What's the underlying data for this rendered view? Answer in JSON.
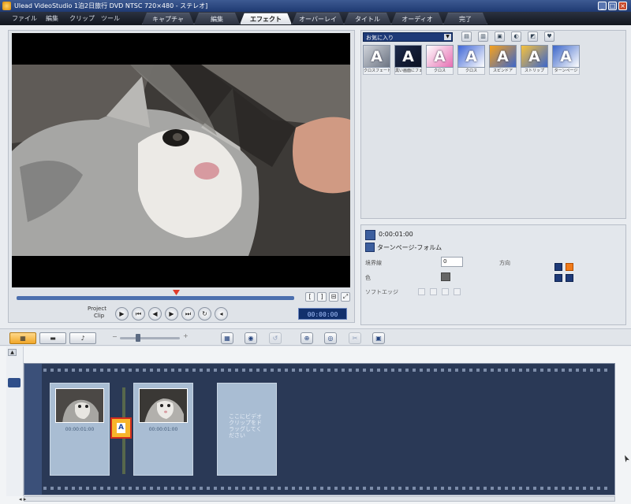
{
  "window": {
    "title": "Ulead VideoStudio 1泊2日旅行 DVD NTSC 720×480 - ステレオ]",
    "controls": [
      "_",
      "□",
      "×"
    ]
  },
  "menu": [
    "ファイル",
    "編集",
    "クリップ",
    "ツール"
  ],
  "step_tabs": [
    {
      "label": "キャプチャ",
      "active": false
    },
    {
      "label": "編集",
      "active": false
    },
    {
      "label": "エフェクト",
      "active": true
    },
    {
      "label": "オーバーレイ",
      "active": false
    },
    {
      "label": "タイトル",
      "active": false
    },
    {
      "label": "オーディオ",
      "active": false
    },
    {
      "label": "完了",
      "active": false
    }
  ],
  "preview": {
    "project_label": "Project",
    "clip_label": "Clip",
    "timecode": "00:00:00",
    "transport_buttons": [
      "play",
      "to-start",
      "prev-frame",
      "next-frame",
      "to-end",
      "repeat",
      "volume"
    ]
  },
  "library": {
    "category": "お気に入り",
    "thumbnails": [
      {
        "caption": "クロスフェード",
        "gradient": "#cfd3da,#6c7482",
        "letter": "A"
      },
      {
        "caption": "黒い画面にフェード",
        "gradient": "#1d2a4a,#0b1022",
        "letter": "A"
      },
      {
        "caption": "クロス",
        "gradient": "#ffffff,#e66fb2",
        "letter": "A"
      },
      {
        "caption": "クロス",
        "gradient": "#3f66d6,#ffffff",
        "letter": "A"
      },
      {
        "caption": "スピンドア",
        "gradient": "#f7a21c,#3c66c9",
        "letter": "A"
      },
      {
        "caption": "ストリップ",
        "gradient": "#f7c23c,#3c66c9",
        "letter": "A"
      },
      {
        "caption": "ターンページ",
        "gradient": "#3c66c9,#ffffff",
        "letter": "A"
      }
    ]
  },
  "options": {
    "duration": "0:00:01:00",
    "effect_name": "ターンページ-フォルム",
    "border_label": "境界線",
    "border_value": "0",
    "color_label": "色",
    "softedge_label": "ソフトエッジ",
    "direction_label": "方向"
  },
  "toolbar": {
    "storyboard_view": "▦",
    "timeline_view": "▬",
    "audio_view": "♪"
  },
  "storyboard": {
    "clips": [
      {
        "label": "00:00:01:00"
      },
      {
        "label": "00:00:01:00"
      }
    ],
    "placeholder": "ここにビデオクリップをドラッグしてください"
  },
  "colors": {
    "active_tab": "#ffffff",
    "timecode_bg": "#12306c",
    "filmstrip": "#2a3956",
    "transition_marker": "#f7b52b"
  }
}
